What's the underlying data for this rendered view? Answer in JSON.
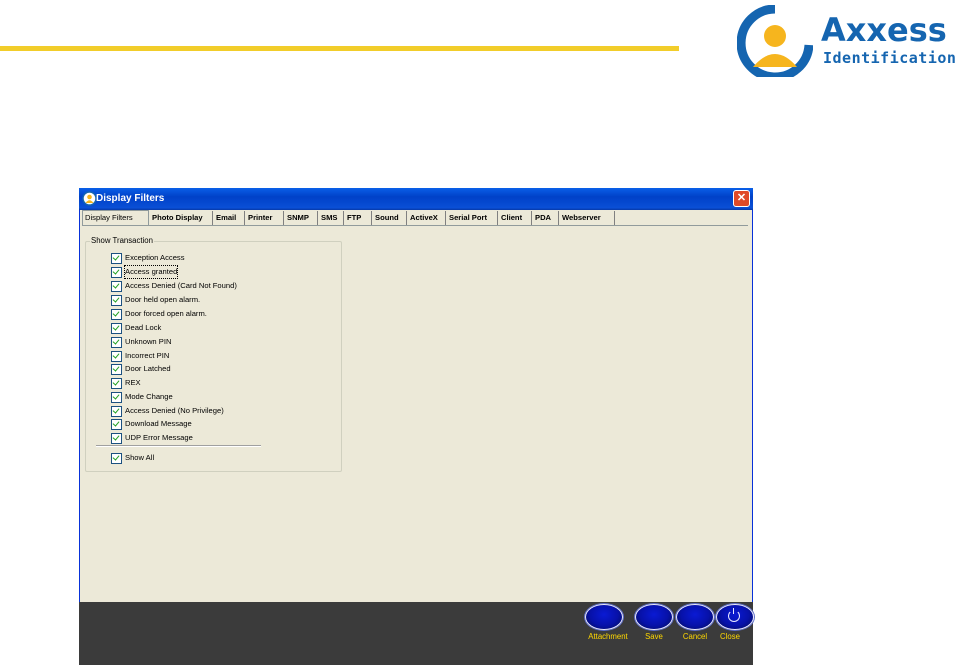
{
  "brand": {
    "name": "Axxess",
    "tagline": "Identification",
    "rule_color": "#f2cd2a",
    "logo_color": "#1565b0"
  },
  "window": {
    "title": "Display Filters",
    "close_symbol": "✕"
  },
  "tabs": [
    {
      "label": "Display Filters",
      "active": true
    },
    {
      "label": "Photo Display",
      "active": false
    },
    {
      "label": "Email",
      "active": false
    },
    {
      "label": "Printer",
      "active": false
    },
    {
      "label": "SNMP",
      "active": false
    },
    {
      "label": "SMS",
      "active": false
    },
    {
      "label": "FTP",
      "active": false
    },
    {
      "label": "Sound",
      "active": false
    },
    {
      "label": "ActiveX",
      "active": false
    },
    {
      "label": "Serial Port",
      "active": false
    },
    {
      "label": "Client",
      "active": false
    },
    {
      "label": "PDA",
      "active": false
    },
    {
      "label": "Webserver",
      "active": false
    }
  ],
  "show_transaction": {
    "legend": "Show Transaction",
    "items": [
      {
        "label": "Exception Access",
        "checked": true
      },
      {
        "label": "Access granted",
        "checked": true,
        "focused": true
      },
      {
        "label": "Access Denied (Card Not Found)",
        "checked": true
      },
      {
        "label": "Door held open alarm.",
        "checked": true
      },
      {
        "label": "Door forced open alarm.",
        "checked": true
      },
      {
        "label": "Dead Lock",
        "checked": true
      },
      {
        "label": "Unknown PIN",
        "checked": true
      },
      {
        "label": "Incorrect PIN",
        "checked": true
      },
      {
        "label": "Door Latched",
        "checked": true
      },
      {
        "label": "REX",
        "checked": true
      },
      {
        "label": "Mode Change",
        "checked": true
      },
      {
        "label": "Access Denied (No Privilege)",
        "checked": true
      },
      {
        "label": "Download Message",
        "checked": true
      },
      {
        "label": "UDP Error Message",
        "checked": true
      }
    ],
    "show_all": {
      "label": "Show All",
      "checked": true
    }
  },
  "footer": {
    "buttons": [
      {
        "label": "Attachment",
        "icon": "blank-oval"
      },
      {
        "label": "Save",
        "icon": "blank-oval"
      },
      {
        "label": "Cancel",
        "icon": "blank-oval"
      },
      {
        "label": "Close",
        "icon": "power-icon"
      }
    ],
    "label_color": "#ffd800"
  }
}
